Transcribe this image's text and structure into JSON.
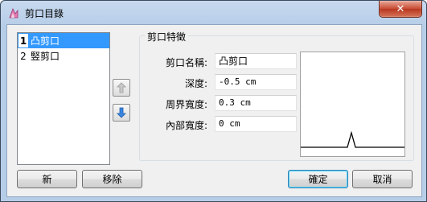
{
  "window": {
    "title": "剪口目錄",
    "close_label": "✕"
  },
  "cut_list": [
    {
      "index": "1",
      "label": "凸剪口",
      "selected": true
    },
    {
      "index": "2",
      "label": "竪剪口",
      "selected": false
    }
  ],
  "properties": {
    "group_title": "剪口特徵",
    "name_label": "剪口名稱:",
    "name_value": "凸剪口",
    "depth_label": "深度:",
    "depth_value": "-0.5 cm",
    "perimeter_width_label": "周界寬度:",
    "perimeter_width_value": "0.3 cm",
    "inner_width_label": "內部寬度:",
    "inner_width_value": "0 cm"
  },
  "buttons": {
    "new_label": "新",
    "remove_label": "移除",
    "ok_label": "確定",
    "cancel_label": "取消"
  },
  "icons": {
    "move_up": "arrow-up-icon",
    "move_down": "arrow-down-icon"
  },
  "colors": {
    "selection": "#3399ff",
    "close_button": "#c74b33",
    "arrow_icon": "#2f6fd0"
  }
}
